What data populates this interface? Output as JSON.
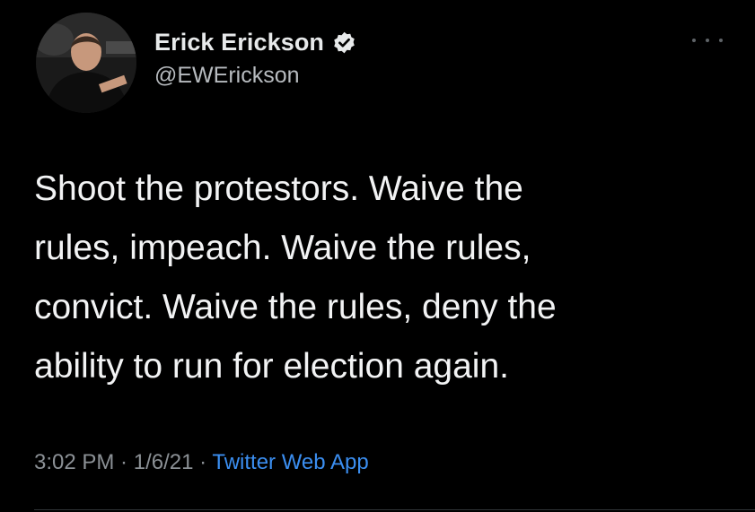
{
  "author": {
    "display_name": "Erick Erickson",
    "handle": "@EWErickson",
    "verified": true,
    "avatar_icon": "profile-photo",
    "verified_icon": "verified-badge-icon"
  },
  "tweet": {
    "text": "Shoot the protestors.  Waive the\nrules, impeach.  Waive the rules,\nconvict.  Waive the rules, deny the\nability to run for election again."
  },
  "meta": {
    "time": "3:02 PM",
    "separator1": " · ",
    "date": "1/6/21",
    "separator2": " · ",
    "source": "Twitter Web App"
  },
  "more_menu_icon": "more-horizontal-icon",
  "colors": {
    "background": "#000000",
    "text": "#f2f3f4",
    "secondary": "#8b9095",
    "link": "#3b8ef0"
  }
}
